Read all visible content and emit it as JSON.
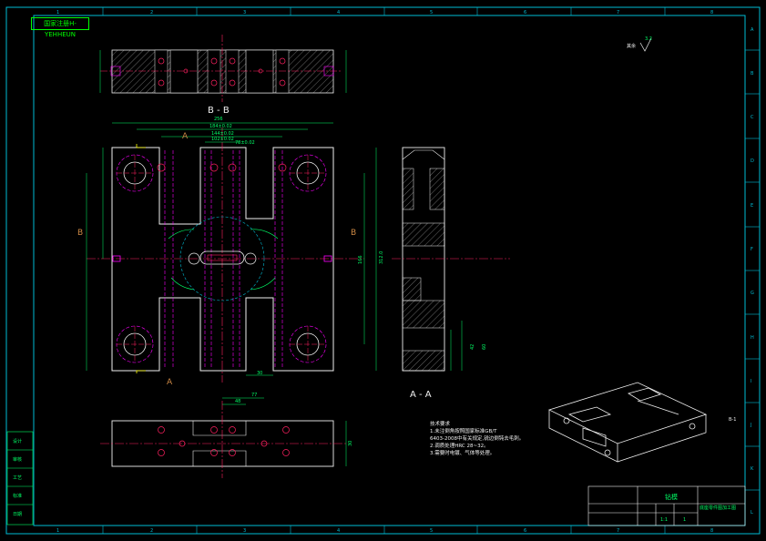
{
  "title_stamp": "国家注册H-YEHHEUN",
  "zone_columns": [
    "1",
    "2",
    "3",
    "4",
    "5",
    "6",
    "7",
    "8"
  ],
  "zone_rows": [
    "A",
    "B",
    "C",
    "D",
    "E",
    "F",
    "G",
    "H",
    "I",
    "J",
    "K",
    "L"
  ],
  "section_labels": {
    "bb": "B - B",
    "aa": "A - A",
    "a_top": "A",
    "a_bottom": "A",
    "b_left": "B",
    "b_right": "B"
  },
  "roughness": {
    "label": "其余",
    "value": "3.2"
  },
  "dimensions": {
    "overall_width": "256",
    "width_2": "184±0.02",
    "width_3": "144±0.02",
    "width_4": "102±0.02",
    "width_5": "78±0.02",
    "height_total": "312.0",
    "height_inner": "166",
    "bottom_slot": "30",
    "view_dim_48": "48",
    "view_dim_77": "77",
    "side_dim_1": "42",
    "side_dim_2": "60",
    "thick": "30"
  },
  "notes": {
    "title": "技术要求",
    "lines": [
      "1.未注倒角按照国家标准GB/T",
      "6403-2008中有关规定,锐边倒钝去毛刺。",
      "2.调质处理HRC 28~32。",
      "3.需要时电镀、气体等处理。"
    ]
  },
  "title_block": {
    "part_name": "钻模",
    "drawing_title": "底座零件图加工图",
    "scale": "1:1",
    "sheet": "1"
  },
  "legend_left": [
    "设计",
    "审核",
    "工艺",
    "标准",
    "日期"
  ],
  "iso_label": "B-1"
}
